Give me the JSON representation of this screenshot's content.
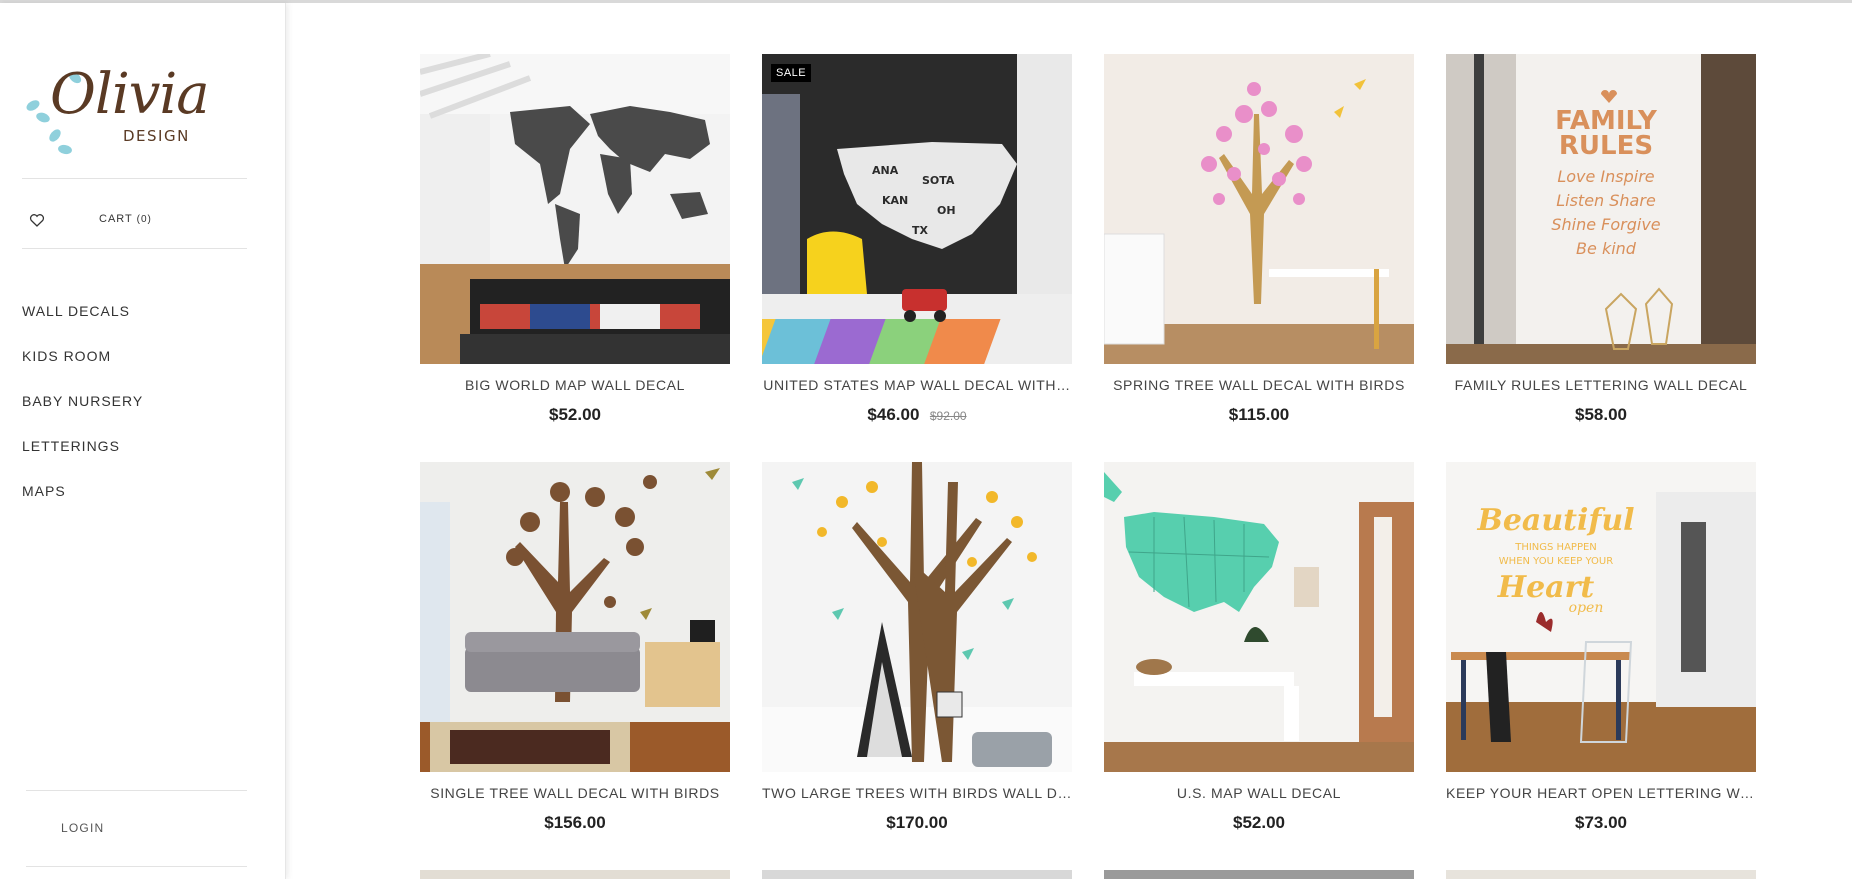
{
  "brand": {
    "name": "Olivia",
    "sub": "DESIGN"
  },
  "cart": {
    "label": "CART",
    "count": "(0)"
  },
  "nav": [
    {
      "label": "WALL DECALS"
    },
    {
      "label": "KIDS ROOM"
    },
    {
      "label": "BABY NURSERY"
    },
    {
      "label": "LETTERINGS"
    },
    {
      "label": "MAPS"
    }
  ],
  "login_label": "LOGIN",
  "products": [
    {
      "title": "BIG WORLD MAP WALL DECAL",
      "price": "$52.00"
    },
    {
      "title": "UNITED STATES MAP WALL DECAL WITH…",
      "price": "$46.00",
      "old_price": "$92.00",
      "badge": "SALE"
    },
    {
      "title": "SPRING TREE WALL DECAL WITH BIRDS",
      "price": "$115.00"
    },
    {
      "title": "FAMILY RULES LETTERING WALL DECAL",
      "price": "$58.00",
      "art": {
        "l1": "FAMILY",
        "l2": "RULES",
        "l3": "Love Inspire",
        "l4": "Listen Share",
        "l5": "Shine Forgive",
        "l6": "Be kind"
      }
    },
    {
      "title": "SINGLE TREE WALL DECAL WITH BIRDS",
      "price": "$156.00"
    },
    {
      "title": "TWO LARGE TREES WITH BIRDS WALL D…",
      "price": "$170.00"
    },
    {
      "title": "U.S. MAP WALL DECAL",
      "price": "$52.00"
    },
    {
      "title": "KEEP YOUR HEART OPEN LETTERING WA…",
      "price": "$73.00",
      "art": {
        "l1": "Beautiful",
        "l2": "THINGS HAPPEN",
        "l3": "WHEN YOU KEEP YOUR",
        "l4": "Heart",
        "l5": "open"
      }
    }
  ],
  "colors": {
    "brand_brown": "#5a3a24",
    "accent_teal": "#8fd0dc",
    "sale_badge": "#000000"
  },
  "icons": {
    "wishlist": "heart-icon"
  }
}
